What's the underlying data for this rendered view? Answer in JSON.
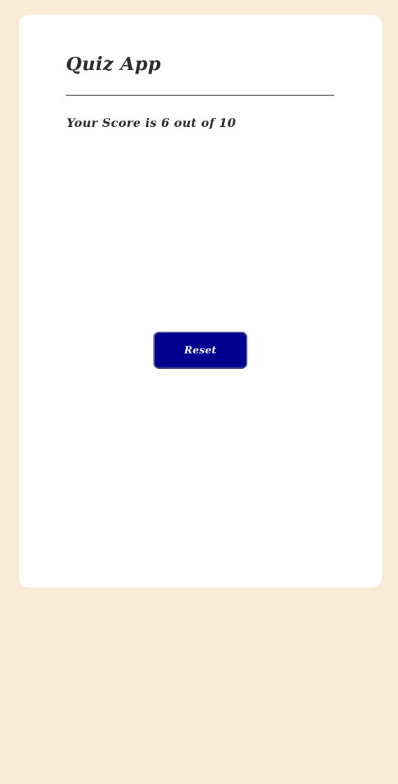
{
  "app": {
    "title": "Quiz App"
  },
  "result": {
    "score_text": "Your Score is 6 out of 10"
  },
  "actions": {
    "reset_label": "Reset"
  },
  "colors": {
    "page_background": "#faebd7",
    "card_background": "#ffffff",
    "button_background": "#000090",
    "button_text": "#ffffff",
    "text": "#2a2a2a",
    "divider": "#7a7a7a"
  }
}
